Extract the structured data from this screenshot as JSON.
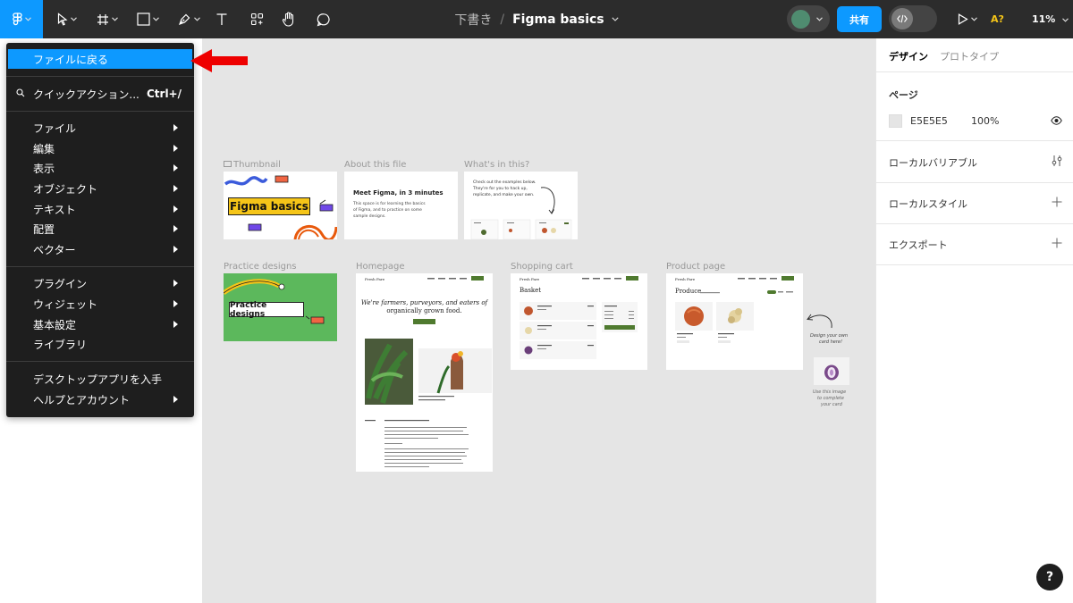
{
  "toolbar": {
    "breadcrumb_folder": "下書き",
    "breadcrumb_sep": "/",
    "file_name": "Figma basics",
    "share_label": "共有",
    "ai_label": "A?",
    "zoom_label": "11%",
    "colors": {
      "bar": "#2c2c2c",
      "accent": "#0d99ff",
      "avatar": "#4f8c70"
    }
  },
  "menu": {
    "back_to_files": "ファイルに戻る",
    "quick_actions": "クイックアクション...",
    "quick_actions_shortcut": "Ctrl+/",
    "group1": [
      "ファイル",
      "編集",
      "表示",
      "オブジェクト",
      "テキスト",
      "配置",
      "ベクター"
    ],
    "group2": [
      "プラグイン",
      "ウィジェット",
      "基本設定",
      "ライブラリ"
    ],
    "get_desktop": "デスクトップアプリを入手",
    "help_account": "ヘルプとアカウント"
  },
  "canvas": {
    "background": "#e5e5e5",
    "frames": {
      "thumbnail": {
        "label": "Thumbnail",
        "title": "Figma basics"
      },
      "about": {
        "label": "About this file",
        "heading": "Meet Figma, in 3 minutes",
        "body1": "This space is for learning the basics",
        "body2": "of Figma, and to practice on some",
        "body3": "sample designs."
      },
      "whats_in": {
        "label": "What's in this?",
        "body1": "Check out the examples below.",
        "body2": "They're for you to hack up,",
        "body3": "replicate, and make your own."
      },
      "practice": {
        "label": "Practice designs",
        "title": "Practice designs"
      },
      "homepage": {
        "label": "Homepage",
        "brand": "Fresh Fare",
        "headline1": "We're farmers, purveyors, and eaters of",
        "headline2": "organically grown food."
      },
      "cart": {
        "label": "Shopping cart",
        "brand": "Fresh Fare",
        "title": "Basket"
      },
      "product": {
        "label": "Product page",
        "brand": "Fresh Fare",
        "title": "Produce"
      }
    },
    "annotations": {
      "design_note1": "Design your own",
      "design_note2": "card here!",
      "use_image1": "Use this image",
      "use_image2": "to complete",
      "use_image3": "your card"
    }
  },
  "right_panel": {
    "tab_design": "デザイン",
    "tab_prototype": "プロトタイプ",
    "page_section": "ページ",
    "page_color": "E5E5E5",
    "page_opacity": "100%",
    "local_variables": "ローカルバリアブル",
    "local_styles": "ローカルスタイル",
    "export": "エクスポート",
    "help_label": "?"
  }
}
